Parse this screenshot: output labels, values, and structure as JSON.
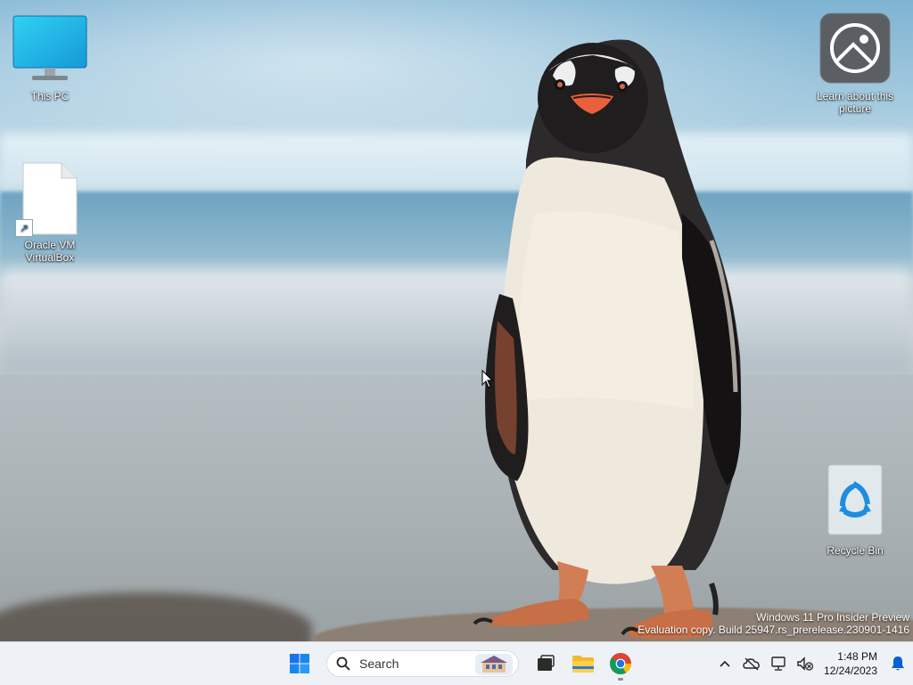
{
  "desktop": {
    "icons": {
      "this_pc": "This PC",
      "virtualbox": "Oracle VM VirtualBox",
      "learn_picture": "Learn about this picture",
      "recycle_bin": "Recycle Bin"
    },
    "watermark": {
      "line1": "Windows 11 Pro Insider Preview",
      "line2": "Evaluation copy. Build 25947.rs_prerelease.230901-1416"
    }
  },
  "taskbar": {
    "search_placeholder": "Search",
    "pinned": [
      "start-icon",
      "search-icon",
      "task-view-icon",
      "file-explorer-icon",
      "chrome-icon"
    ],
    "tray": {
      "icons": [
        "chevron-up-icon",
        "onedrive-icon",
        "network-icon",
        "volume-muted-icon",
        "notification-bell-icon"
      ],
      "time": "1:48 PM",
      "date": "12/24/2023"
    }
  },
  "colors": {
    "taskbar_bg": "#eef1f5",
    "accent_blue": "#0a5fd6",
    "chrome_red": "#db4437",
    "chrome_yellow": "#f4c20d",
    "chrome_green": "#0f9d58"
  }
}
